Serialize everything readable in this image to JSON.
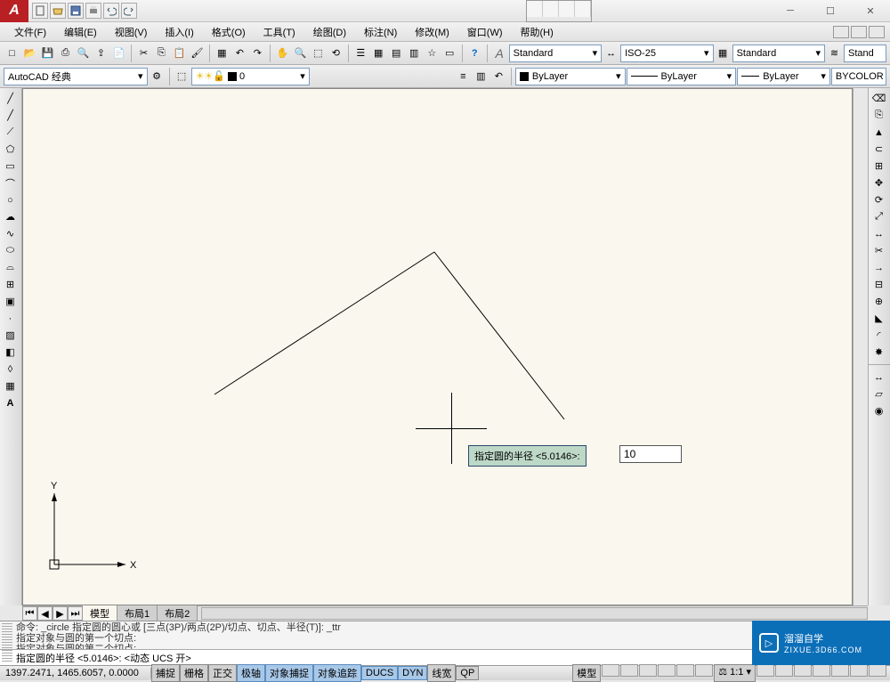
{
  "title_right_search_icons": [
    "magnify",
    "cursor",
    "key",
    "star"
  ],
  "menu": [
    "文件(F)",
    "编辑(E)",
    "视图(V)",
    "插入(I)",
    "格式(O)",
    "工具(T)",
    "绘图(D)",
    "标注(N)",
    "修改(M)",
    "窗口(W)",
    "帮助(H)"
  ],
  "workspace": {
    "label": "AutoCAD 经典"
  },
  "style_combos": {
    "text": "Standard",
    "dim": "ISO-25",
    "table": "Standard",
    "ml": "Stand"
  },
  "layer": {
    "display": "0"
  },
  "props": {
    "color": "ByLayer",
    "linetype": "ByLayer",
    "lineweight": "ByLayer",
    "plot": "BYCOLOR"
  },
  "prompt": {
    "label": "指定圆的半径 <5.0146>:",
    "value": "10"
  },
  "tabs": [
    "模型",
    "布局1",
    "布局2"
  ],
  "active_tab": 0,
  "cmd_history": "命令: _circle 指定圆的圆心或 [三点(3P)/两点(2P)/切点、切点、半径(T)]: _ttr\n指定对象与圆的第一个切点:\n指定对象与圆的第二个切点:",
  "cmd_input": "指定圆的半径 <5.0146>:  <动态 UCS 开>",
  "status": {
    "coords": "1397.2471, 1465.6057, 0.0000",
    "toggles": [
      "捕捉",
      "栅格",
      "正交",
      "极轴",
      "对象捕捉",
      "对象追踪",
      "DUCS",
      "DYN",
      "线宽",
      "QP"
    ],
    "on": [
      3,
      4,
      5,
      6,
      7
    ],
    "right_label": "模型",
    "scale": "1:1"
  },
  "watermark": {
    "brand": "溜溜自学",
    "url": "ZIXUE.3D66.COM"
  },
  "ucs": {
    "x": "X",
    "y": "Y"
  }
}
